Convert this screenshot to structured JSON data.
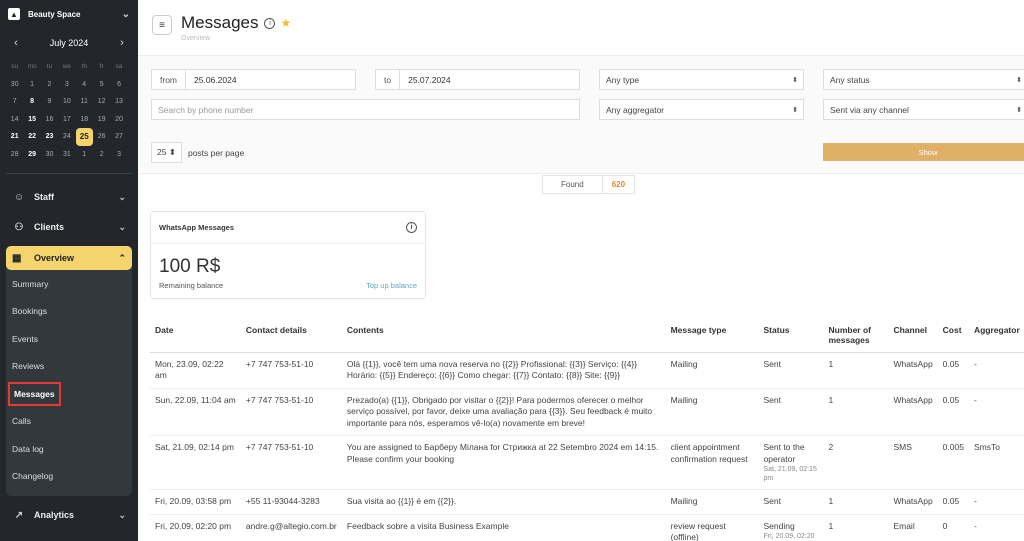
{
  "app": {
    "name": "Beauty Space"
  },
  "calendar": {
    "month_label": "July 2024",
    "weekdays": [
      "su",
      "mo",
      "tu",
      "we",
      "th",
      "fr",
      "sa"
    ],
    "days": [
      "30",
      "1",
      "2",
      "3",
      "4",
      "5",
      "6",
      "7",
      "8",
      "9",
      "10",
      "11",
      "12",
      "13",
      "14",
      "15",
      "16",
      "17",
      "18",
      "19",
      "20",
      "21",
      "22",
      "23",
      "24",
      "25",
      "26",
      "27",
      "28",
      "29",
      "30",
      "31",
      "1",
      "2",
      "3"
    ],
    "today": "25"
  },
  "sidebar": {
    "staff": "Staff",
    "clients": "Clients",
    "overview": "Overview",
    "sub_items": [
      "Summary",
      "Bookings",
      "Events",
      "Reviews",
      "Messages",
      "Calls",
      "Data log",
      "Changelog"
    ],
    "analytics": "Analytics"
  },
  "header": {
    "title": "Messages",
    "subtitle": "Overview"
  },
  "filters": {
    "from_label": "from",
    "from_value": "25.06.2024",
    "to_label": "to",
    "to_value": "25.07.2024",
    "type": "Any type",
    "status": "Any status",
    "search_placeholder": "Search by phone number",
    "aggregator": "Any aggregator",
    "channel": "Sent via any channel",
    "per_page_value": "25",
    "per_page_label": "posts per page",
    "show_label": "Show"
  },
  "found": {
    "label": "Found",
    "count": "620"
  },
  "whatsapp": {
    "title": "WhatsApp Messages",
    "balance": "100 R$",
    "balance_label": "Remaining balance",
    "topup": "Top up balance"
  },
  "table": {
    "headers": [
      "Date",
      "Contact details",
      "Contents",
      "Message type",
      "Status",
      "Number of messages",
      "Channel",
      "Cost",
      "Aggregator"
    ],
    "rows": [
      {
        "date": "Mon, 23.09, 02:22 am",
        "contact": "+7 747 753-51-10",
        "contents": "Olá {{1}}, você tem uma nova reserva no {{2}} Profissional: {{3}} Serviço: {{4}} Horário: {{5}} Endereço: {{6}} Como chegar: {{7}} Contato: {{8}} Site: {{9}}",
        "type": "Mailing",
        "status": "Sent",
        "status_sub": "",
        "count": "1",
        "channel": "WhatsApp",
        "cost": "0.05",
        "aggregator": "-"
      },
      {
        "date": "Sun, 22.09, 11:04 am",
        "contact": "+7 747 753-51-10",
        "contents": "Prezado(a) {{1}}, Obrigado por visitar o {{2}}! Para podermos oferecer o melhor serviço possível, por favor, deixe uma avaliação para {{3}}. Seu feedback é muito importante para nós, esperamos vê-lo(a) novamente em breve!",
        "type": "Mailing",
        "status": "Sent",
        "status_sub": "",
        "count": "1",
        "channel": "WhatsApp",
        "cost": "0.05",
        "aggregator": "-"
      },
      {
        "date": "Sat, 21.09, 02:14 pm",
        "contact": "+7 747 753-51-10",
        "contents": "You are assigned to Барберу Мілана for Стрижка at 22 Setembro 2024 em 14:15. Please confirm your booking",
        "type": "client appointment confirmation request",
        "status": "Sent to the operator",
        "status_sub": "Sat, 21.09, 02:15 pm",
        "count": "2",
        "channel": "SMS",
        "cost": "0.005",
        "aggregator": "SmsTo"
      },
      {
        "date": "Fri, 20.09, 03:58 pm",
        "contact": "+55 11-93044-3283",
        "contents": "Sua visita ao {{1}} é em {{2}}.",
        "type": "Mailing",
        "status": "Sent",
        "status_sub": "",
        "count": "1",
        "channel": "WhatsApp",
        "cost": "0.05",
        "aggregator": "-"
      },
      {
        "date": "Fri, 20.09, 02:20 pm",
        "contact": "andre.g@altegio.com.br",
        "contents": "Feedback sobre a visita Business Example",
        "type": "review request (offline)",
        "status": "Sending",
        "status_sub": "Fri, 20.09, 02:20",
        "count": "1",
        "channel": "Email",
        "cost": "0",
        "aggregator": "-"
      }
    ]
  }
}
